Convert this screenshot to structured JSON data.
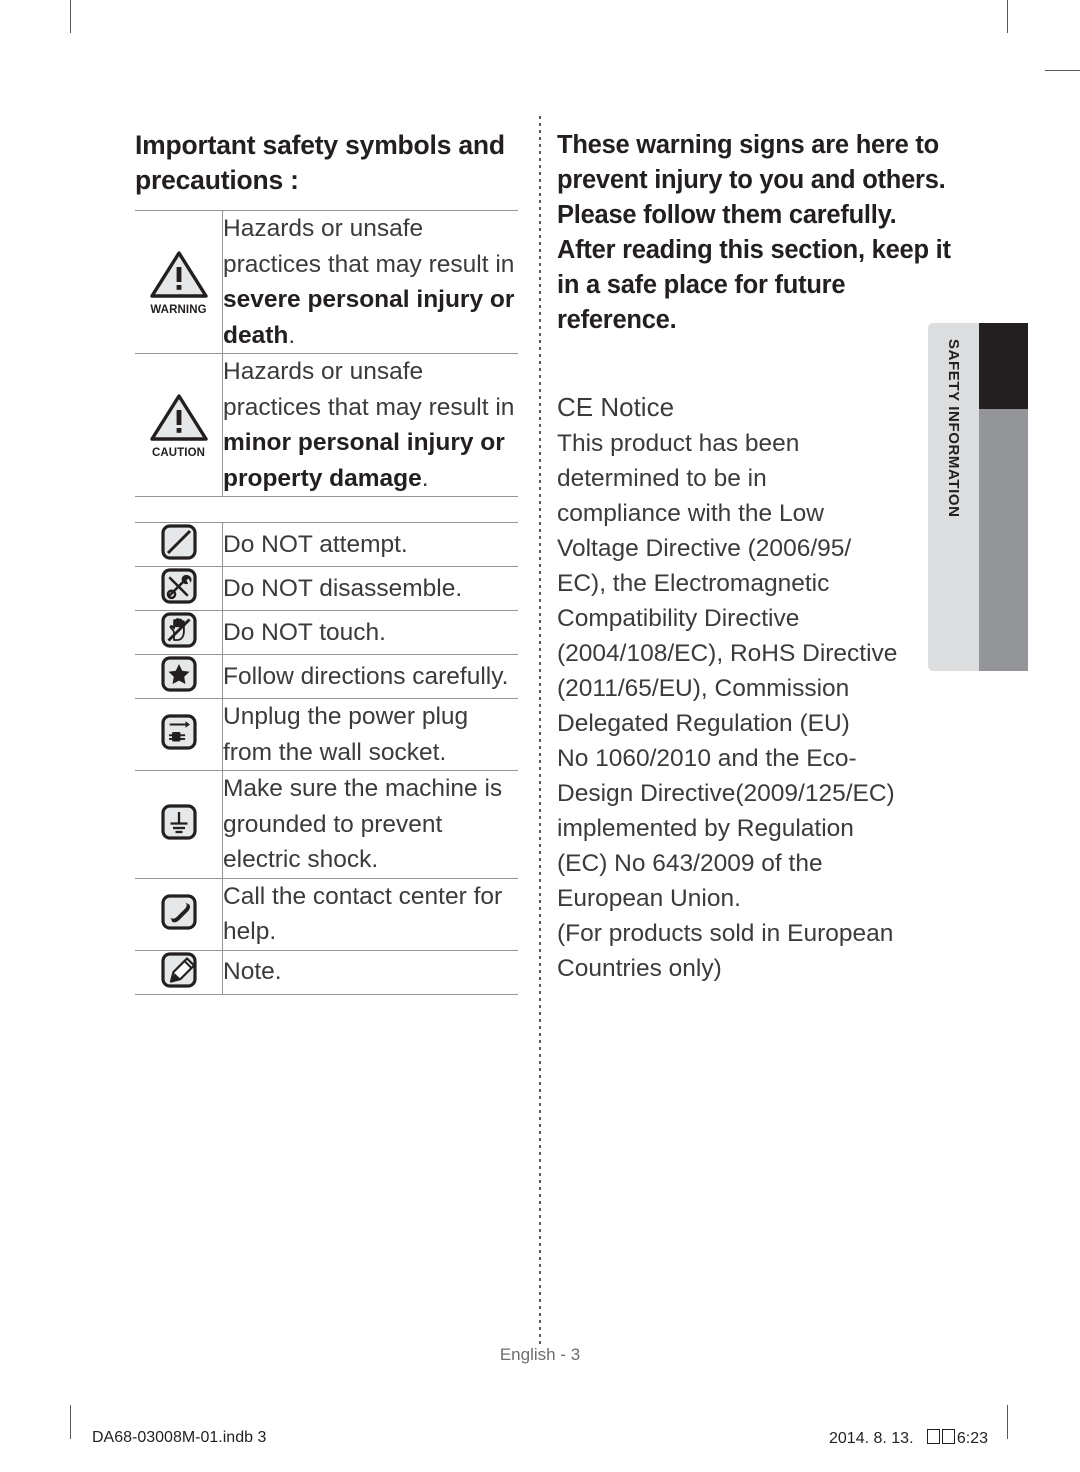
{
  "left": {
    "heading": "Important safety symbols and precautions :",
    "severity_rows": [
      {
        "symbol": "warning-triangle-icon",
        "symbol_label": "WARNING",
        "text_plain": "Hazards or unsafe practices that may result in ",
        "text_bold": "severe personal injury or death",
        "text_tail": "."
      },
      {
        "symbol": "caution-triangle-icon",
        "symbol_label": "CAUTION",
        "text_plain": "Hazards or unsafe practices that may result in ",
        "text_bold": "minor personal injury or property damage",
        "text_tail": "."
      }
    ],
    "instruction_rows": [
      {
        "symbol": "do-not-attempt-icon",
        "text": "Do NOT attempt."
      },
      {
        "symbol": "do-not-disassemble-icon",
        "text": "Do NOT disassemble."
      },
      {
        "symbol": "do-not-touch-icon",
        "text": "Do NOT touch."
      },
      {
        "symbol": "follow-directions-icon",
        "text": "Follow directions carefully."
      },
      {
        "symbol": "unplug-power-icon",
        "text": "Unplug the power plug from the wall socket."
      },
      {
        "symbol": "grounding-icon",
        "text": "Make sure the machine is grounded to prevent electric shock."
      },
      {
        "symbol": "call-contact-center-icon",
        "text": "Call the contact center for help."
      },
      {
        "symbol": "note-pencil-icon",
        "text": "Note."
      }
    ]
  },
  "right": {
    "lead_lines": [
      "These warning signs are",
      "here to prevent injury to you",
      "and others.",
      "Please follow them carefully.",
      "After reading this section,",
      "keep it in a safe place for",
      "future reference."
    ],
    "ce_title": "CE Notice",
    "ce_lines": [
      "This product has been",
      "determined to be in",
      "compliance with the Low",
      "Voltage Directive (2006/95/",
      "EC), the Electromagnetic",
      "Compatibility Directive",
      "(2004/108/EC), RoHS Directive",
      "(2011/65/EU), Commission",
      "Delegated Regulation (EU)",
      "No 1060/2010 and the Eco-",
      "Design Directive(2009/125/EC)",
      "implemented by Regulation",
      "(EC) No 643/2009 of the",
      "European Union.",
      "(For products sold in European",
      "Countries only)"
    ]
  },
  "side_tab": {
    "label": "SAFETY INFORMATION",
    "light_color": "#dcddde",
    "dark_color": "#939598",
    "active_color": "#231f20"
  },
  "footer": {
    "page_label": "English - 3",
    "print_file": "DA68-03008M-01.indb   3",
    "print_date": "2014. 8. 13.",
    "print_time": "6:23"
  }
}
